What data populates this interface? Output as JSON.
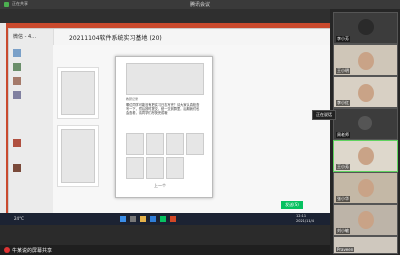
{
  "app": {
    "title": "腾讯会议",
    "top_left_label": "正在共享"
  },
  "chat": {
    "title": "20211104软件系统实习基地 (20)",
    "sidebar_label": "微信 - 4…",
    "popup_caption": "教研记录",
    "popup_text": "哪位同学可能没有把实习日志写完？请大家认真检查写一下，然后按时提交，统一交到群里，后期我们也会查看，请同学们尽快完成哦",
    "popup_nav": "上一个",
    "send_button": "发送(S)"
  },
  "taskbar": {
    "weather": "24°C",
    "time": "12:11",
    "date": "2021/11/4"
  },
  "status_bar": {
    "text": "牛某说的屏幕共享"
  },
  "participants": [
    {
      "name": "李小芳"
    },
    {
      "name": "王小明"
    },
    {
      "name": "李小红"
    },
    {
      "name": "周老师"
    },
    {
      "name": "王小芳"
    },
    {
      "name": "张小华"
    },
    {
      "name": "刘小敏"
    },
    {
      "name": "Praveen"
    }
  ],
  "tooltip": "正在说话"
}
